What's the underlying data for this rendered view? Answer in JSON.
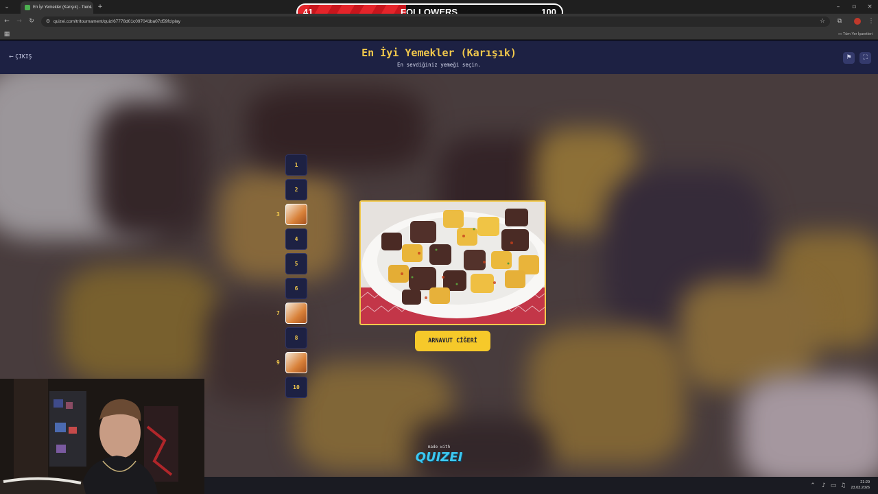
{
  "browser": {
    "tab_title": "En İyi Yemekler (Karışık) - Tier L",
    "url": "quizei.com/tr/tournament/quiz/67778d01c097041ba07d59fc/play",
    "bookmarks_label": "Tüm Yer İşaretleri"
  },
  "overlay": {
    "current": "41",
    "label": "FOLLOWERS",
    "goal": "100",
    "progress": 0.41
  },
  "header": {
    "back_label": "ÇIKIŞ",
    "title": "En İyi Yemekler (Karışık)",
    "subtitle": "En sevdiğiniz yemeği seçin."
  },
  "rounds": [
    {
      "n": "1",
      "done": false
    },
    {
      "n": "2",
      "done": false
    },
    {
      "n": "3",
      "done": true
    },
    {
      "n": "4",
      "done": false
    },
    {
      "n": "5",
      "done": false
    },
    {
      "n": "6",
      "done": false
    },
    {
      "n": "7",
      "done": true
    },
    {
      "n": "8",
      "done": false
    },
    {
      "n": "9",
      "done": true
    },
    {
      "n": "10",
      "done": false
    }
  ],
  "item": {
    "name": "ARNAVUT CİĞERİ"
  },
  "footer": {
    "made_with": "made with",
    "brand": "QUIZEI"
  },
  "taskbar": {
    "time": "21:29",
    "date": "23.03.2026"
  },
  "colors": {
    "accent": "#f2c94c",
    "header_bg": "#1d2143",
    "button": "#f6c92a"
  }
}
